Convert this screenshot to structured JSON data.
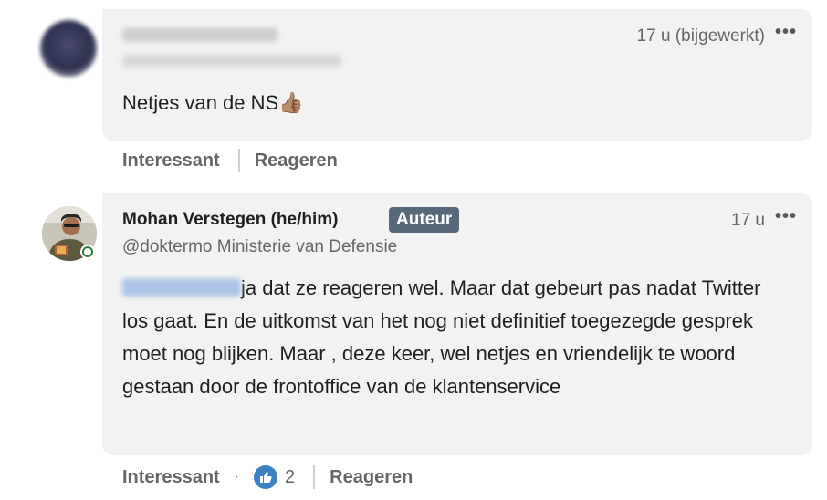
{
  "comment1": {
    "time": "17 u (bijgewerkt)",
    "more": "•••",
    "text": "Netjes van de NS",
    "emoji": "👍🏽",
    "actions": {
      "interesting": "Interessant",
      "reply": "Reageren"
    }
  },
  "comment2": {
    "author": "Mohan Verstegen (he/him)",
    "badge": "Auteur",
    "handle": "@doktermo Ministerie van Defensie",
    "time": "17 u",
    "more": "•••",
    "text": "ja dat ze reageren wel. Maar dat gebeurt pas nadat Twitter los gaat. En de uitkomst van het nog niet definitief toegezegde gesprek moet nog blijken. Maar , deze keer,  wel netjes en vriendelijk te woord gestaan door de frontoffice van de klantenservice",
    "actions": {
      "interesting": "Interessant",
      "separator": "·",
      "like_count": "2",
      "reply": "Reageren"
    }
  },
  "colors": {
    "bubble": "#f2f2f2",
    "badge": "#56687a",
    "like": "#3b82c4",
    "online": "#2e7d32"
  }
}
